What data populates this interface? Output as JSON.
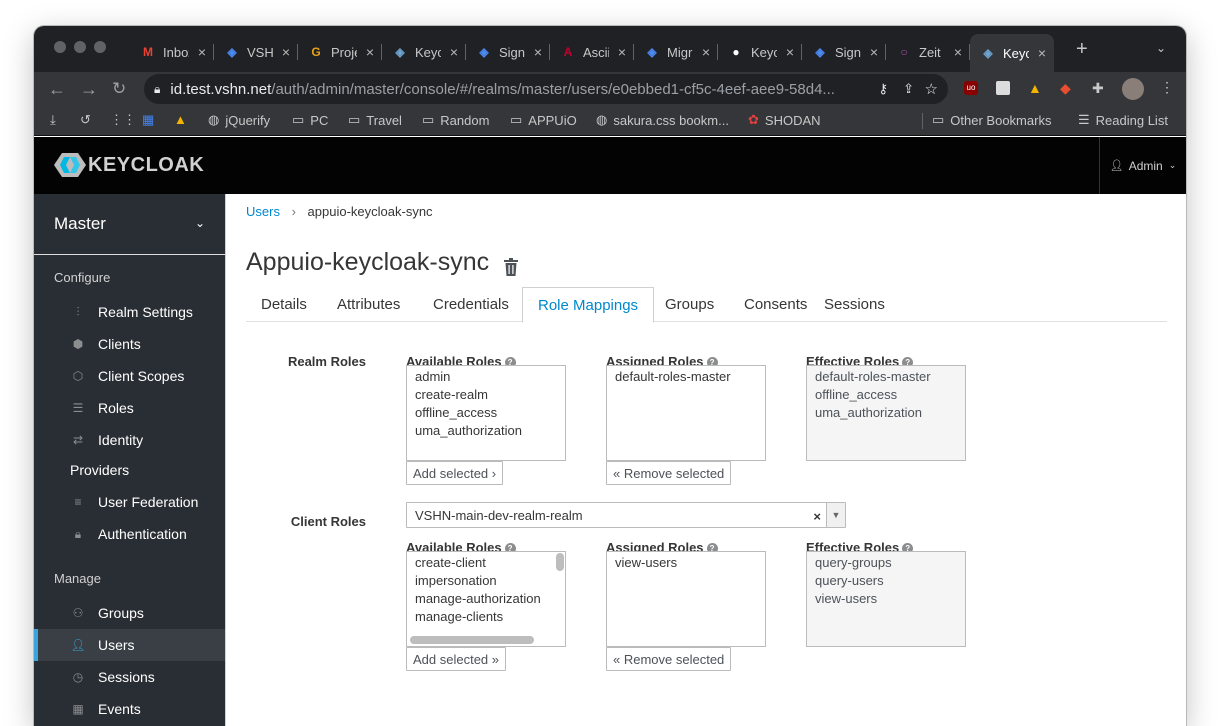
{
  "browser": {
    "tabs": [
      {
        "label": "Inbox",
        "icon": "gmail-icon",
        "color": "#ea4335"
      },
      {
        "label": "VSHN",
        "icon": "vshn-icon",
        "color": "#4b8bf5"
      },
      {
        "label": "Project",
        "icon": "gi-icon",
        "color": "#e8a317"
      },
      {
        "label": "Keycloak",
        "icon": "keycloak-icon",
        "color": "#6ea4d1"
      },
      {
        "label": "Sign",
        "icon": "vshn-icon",
        "color": "#4b8bf5"
      },
      {
        "label": "Ascii",
        "icon": "angular-icon",
        "color": "#c3002f"
      },
      {
        "label": "Migr",
        "icon": "vshn-icon",
        "color": "#4b8bf5"
      },
      {
        "label": "Keycloak",
        "icon": "github-icon",
        "color": "#ffffff"
      },
      {
        "label": "Sign",
        "icon": "vshn-icon",
        "color": "#4b8bf5"
      },
      {
        "label": "Zeit",
        "icon": "circle-icon",
        "color": "#b04ab0"
      },
      {
        "label": "Keycloak",
        "icon": "keycloak-icon",
        "color": "#6ea4d1"
      }
    ],
    "url_host": "id.test.vshn.net",
    "url_path": "/auth/admin/master/console/#/realms/master/users/e0ebbed1-cf5c-4eef-aee9-58d4...",
    "bookmarks": [
      {
        "label": "",
        "icon": "download-icon"
      },
      {
        "label": "",
        "icon": "history-icon"
      },
      {
        "label": "",
        "icon": "apps-grid-icon"
      },
      {
        "label": "",
        "icon": "calendar-icon"
      },
      {
        "label": "",
        "icon": "drive-icon"
      },
      {
        "label": "jQuerify",
        "icon": "globe-icon"
      },
      {
        "label": "PC",
        "icon": "folder-icon"
      },
      {
        "label": "Travel",
        "icon": "folder-icon"
      },
      {
        "label": "Random",
        "icon": "folder-icon"
      },
      {
        "label": "APPUiO",
        "icon": "folder-icon"
      },
      {
        "label": "sakura.css bookm...",
        "icon": "globe-icon"
      },
      {
        "label": "SHODAN",
        "icon": "shodan-icon"
      },
      {
        "label": "Other Bookmarks",
        "icon": "folder-icon"
      },
      {
        "label": "Reading List",
        "icon": "reading-list-icon"
      }
    ]
  },
  "app": {
    "logo_text": "KEYCLOAK",
    "user_menu": "Admin"
  },
  "sidebar": {
    "realm": "Master",
    "configure_label": "Configure",
    "configure_items": [
      {
        "label": "Realm Settings",
        "icon": "sliders-icon"
      },
      {
        "label": "Clients",
        "icon": "cube-icon"
      },
      {
        "label": "Client Scopes",
        "icon": "cubes-icon"
      },
      {
        "label": "Roles",
        "icon": "list-icon"
      },
      {
        "label": "Identity",
        "icon": "exchange-icon"
      },
      {
        "label": "Providers",
        "icon": ""
      },
      {
        "label": "User Federation",
        "icon": "database-icon"
      },
      {
        "label": "Authentication",
        "icon": "lock-icon"
      }
    ],
    "manage_label": "Manage",
    "manage_items": [
      {
        "label": "Groups",
        "icon": "users-icon"
      },
      {
        "label": "Users",
        "icon": "user-icon"
      },
      {
        "label": "Sessions",
        "icon": "clock-icon"
      },
      {
        "label": "Events",
        "icon": "calendar-icon"
      }
    ]
  },
  "main": {
    "breadcrumb_link": "Users",
    "breadcrumb_sep": "›",
    "breadcrumb_current": "appuio-keycloak-sync",
    "title": "Appuio-keycloak-sync",
    "tabs": [
      "Details",
      "Attributes",
      "Credentials",
      "Role Mappings",
      "Groups",
      "Consents",
      "Sessions"
    ],
    "active_tab": "Role Mappings",
    "realm_roles": {
      "label": "Realm Roles",
      "available_label": "Available Roles",
      "available": [
        "admin",
        "create-realm",
        "offline_access",
        "uma_authorization"
      ],
      "assigned_label": "Assigned Roles",
      "assigned": [
        "default-roles-master"
      ],
      "effective_label": "Effective Roles",
      "effective": [
        "default-roles-master",
        "offline_access",
        "uma_authorization"
      ],
      "add_button": "Add selected ›",
      "remove_button": "« Remove selected"
    },
    "client_roles": {
      "label": "Client Roles",
      "selected_client": "VSHN-main-dev-realm-realm",
      "clear_glyph": "×",
      "dropdown_glyph": "▼",
      "available_label": "Available Roles",
      "available": [
        "create-client",
        "impersonation",
        "manage-authorization",
        "manage-clients"
      ],
      "assigned_label": "Assigned Roles",
      "assigned": [
        "view-users"
      ],
      "effective_label": "Effective Roles",
      "effective": [
        "query-groups",
        "query-users",
        "view-users"
      ],
      "add_button": "Add selected »",
      "remove_button": "« Remove selected"
    }
  }
}
